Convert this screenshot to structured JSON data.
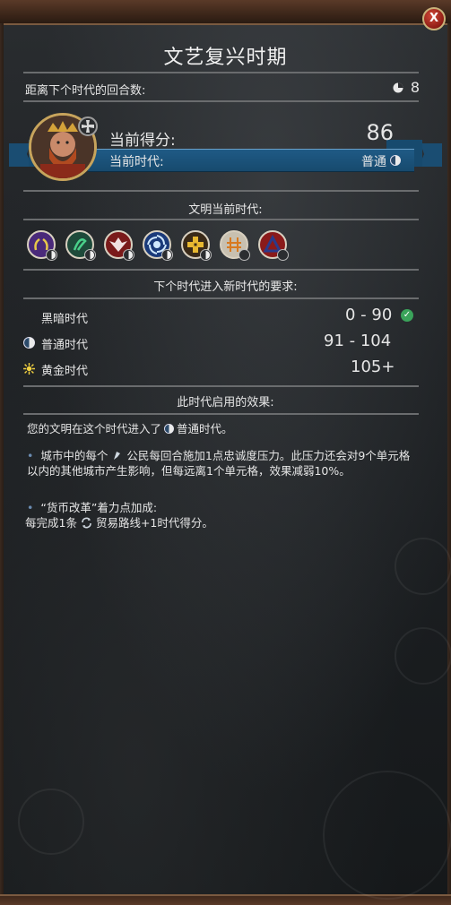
{
  "window": {
    "title": "文艺复兴时期",
    "close_label": "X"
  },
  "turns": {
    "label": "距离下个时代的回合数:",
    "value": "8",
    "icon": "clock-icon"
  },
  "leader": {
    "portrait": "leader-portrait",
    "badge_icon": "iron-cross-icon",
    "score_label": "当前得分:",
    "score_value": "86",
    "era_label": "当前时代:",
    "era_value": "普通",
    "era_icon": "half-moon-icon"
  },
  "civ_section": {
    "heading": "文明当前时代:",
    "civs": [
      {
        "icon": "laurel-wreath-icon",
        "bg": "#4a2a7a",
        "mini": "half-moon-icon"
      },
      {
        "icon": "serpent-icon",
        "bg": "#1e4a3a",
        "mini": "half-moon-icon"
      },
      {
        "icon": "eagle-icon",
        "bg": "#7a1a1a",
        "mini": "half-moon-icon"
      },
      {
        "icon": "swirl-icon",
        "bg": "#1a3a7a",
        "mini": "half-moon-icon"
      },
      {
        "icon": "cross-pattern-icon",
        "bg": "#3a2a18",
        "mini": "half-moon-icon"
      },
      {
        "icon": "rune-icon",
        "bg": "#c8c0b0",
        "mini": "crescent-icon"
      },
      {
        "icon": "triangle-icon",
        "bg": "#8a1a1a",
        "mini": "crescent-icon"
      }
    ]
  },
  "requirements": {
    "heading": "下个时代进入新时代的要求:",
    "rows": [
      {
        "name": "黑暗时代",
        "range": "0 - 90",
        "icon": "crescent-icon",
        "met": true
      },
      {
        "name": "普通时代",
        "range": "91 - 104",
        "icon": "half-moon-icon",
        "met": false
      },
      {
        "name": "黄金时代",
        "range": "105+",
        "icon": "sun-icon",
        "met": false
      }
    ]
  },
  "effects": {
    "heading": "此时代启用的效果:",
    "intro_prefix": "您的文明在这个时代进入了",
    "intro_suffix": "普通时代。",
    "item1_prefix": "城市中的每个",
    "item1_rest": "公民每回合施加1点忠诚度压力。此压力还会对9个单元格以内的其他城市产生影响，但每远离1个单元格，效果减弱10%。",
    "item2_line1": "“货币改革”着力点加成:",
    "item2_prefix": "每完成1条",
    "item2_rest": "贸易路线+1时代得分。"
  },
  "colors": {
    "accent_blue": "#1f5a85",
    "gold": "#c7a45c",
    "check_green": "#3aa35a",
    "rule": "#6a6c6e"
  }
}
